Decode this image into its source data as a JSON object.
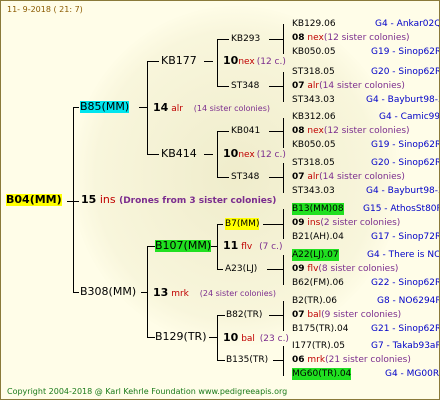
{
  "header": {
    "date": "11-   9-2018 (  21:   7)"
  },
  "footer": {
    "copyright": "Copyright 2004-2018 @ Karl Kehrle Foundation     www.pedigreeapis.org"
  },
  "colors": {
    "link_blue": "#0000c8",
    "red": "#c00000",
    "purple": "#7b2d8e",
    "yellow_highlight": "#ffff00",
    "cyan_highlight": "#00e5ee",
    "green_highlight": "#20e020"
  },
  "root": {
    "name": "B04(MM)",
    "generation": "15",
    "breed": "ins",
    "drones_note": "(Drones from 3 sister colonies)"
  },
  "gen1": {
    "top": {
      "name": "B85(MM)",
      "generation": "14",
      "breed": "alr",
      "colonies": "(14 sister colonies)"
    },
    "bottom": {
      "name": "B308(MM)",
      "generation": "13",
      "breed": "mrk",
      "colonies": "(24 sister colonies)"
    }
  },
  "gen2": {
    "kb177": {
      "name": "KB177",
      "generation": "10",
      "breed": "nex",
      "colonies": "(12 c.)"
    },
    "kb414": {
      "name": "KB414",
      "generation": "10",
      "breed": "nex",
      "colonies": "(12 c.)"
    },
    "b107": {
      "name": "B107(MM)",
      "generation": "11",
      "breed": "flv",
      "colonies": "(7 c.)"
    },
    "b129": {
      "name": "B129(TR)",
      "generation": "10",
      "breed": "bal",
      "colonies": "(23 c.)"
    }
  },
  "gen3": {
    "kb293": "KB293",
    "st348a": "ST348",
    "kb041": "KB041",
    "st348b": "ST348",
    "b7": "B7(MM)",
    "a23": "A23(LJ)",
    "b82": "B82(TR)",
    "b135": "B135(TR)"
  },
  "gen4": [
    {
      "top": "KB129.06",
      "top_link": "G4 - Ankar02Q",
      "gen": "08",
      "breed": "nex",
      "colonies": "(12 sister colonies)",
      "bottom": "KB050.05",
      "bottom_link": "G19 - Sinop62R"
    },
    {
      "top": "ST318.05",
      "top_link": "G20 - Sinop62R",
      "gen": "07",
      "breed": "alr",
      "colonies": "(14 sister colonies)",
      "bottom": "ST343.03",
      "bottom_link": "G4 - Bayburt98-3"
    },
    {
      "top": "KB312.06",
      "top_link": "G4 - Camic99R",
      "gen": "08",
      "breed": "nex",
      "colonies": "(12 sister colonies)",
      "bottom": "KB050.05",
      "bottom_link": "G19 - Sinop62R"
    },
    {
      "top": "ST318.05",
      "top_link": "G20 - Sinop62R",
      "gen": "07",
      "breed": "alr",
      "colonies": "(14 sister colonies)",
      "bottom": "ST343.03",
      "bottom_link": "G4 - Bayburt98-3"
    },
    {
      "top": "B13(MM)08",
      "top_link": "G15 - AthosSt80R",
      "gen": "09",
      "breed": "ins",
      "colonies": "(2 sister colonies)",
      "bottom": "B21(AH).04",
      "bottom_link": "G17 - Sinop72R"
    },
    {
      "top": "A22(LJ).07",
      "top_link": "G4 - There is NO",
      "gen": "09",
      "breed": "flv",
      "colonies": "(8 sister colonies)",
      "bottom": "B62(FM).06",
      "bottom_link": "G22 - Sinop62R"
    },
    {
      "top": "B2(TR).06",
      "top_link": "G8 - NO6294R",
      "gen": "07",
      "breed": "bal",
      "colonies": "(9 sister colonies)",
      "bottom": "B175(TR).04",
      "bottom_link": "G21 - Sinop62R"
    },
    {
      "top": "I177(TR).05",
      "top_link": "G7 - Takab93aR",
      "gen": "06",
      "breed": "mrk",
      "colonies": "(21 sister colonies)",
      "bottom": "MG60(TR).04",
      "bottom_link": "G4 - MG00R"
    }
  ]
}
